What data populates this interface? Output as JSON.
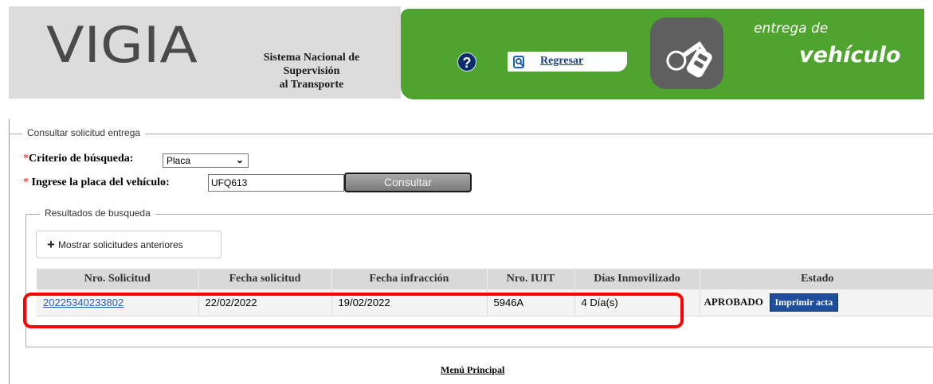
{
  "header": {
    "logo_text": "VIGIA",
    "system_name_lines": [
      "Sistema Nacional de",
      "Supervisión",
      "al Transporte"
    ],
    "help_icon": "question-circle-icon",
    "back_label": "Regresar",
    "banner_line1": "entrega de",
    "banner_line2": "vehículo",
    "colors": {
      "green": "#4ea42e",
      "gray": "#dcdcdc",
      "navy": "#0a2d6e"
    }
  },
  "consulta": {
    "legend": "Consultar solicitud entrega",
    "criterio_label": "Criterio de búsqueda:",
    "criterio_value": "Placa",
    "placa_label": "Ingrese la placa del vehículo:",
    "placa_value": "UFQ613",
    "consultar_label": "Consultar",
    "required_marker": "*"
  },
  "resultados": {
    "legend": "Resultados de busqueda",
    "mostrar_label": "Mostrar solicitudes anteriores",
    "columns": [
      "Nro. Solicitud",
      "Fecha solicitud",
      "Fecha infracción",
      "Nro. IUIT",
      "Días Inmovilizado",
      "Estado"
    ],
    "rows": [
      {
        "nro_solicitud": "20225340233802",
        "fecha_solicitud": "22/02/2022",
        "fecha_infraccion": "19/02/2022",
        "nro_iuit": "5946A",
        "dias": "4 Día(s)",
        "estado": "APROBADO",
        "imprimir_label": "Imprimir acta"
      }
    ]
  },
  "footer": {
    "menu_label": "Menú Principal"
  }
}
